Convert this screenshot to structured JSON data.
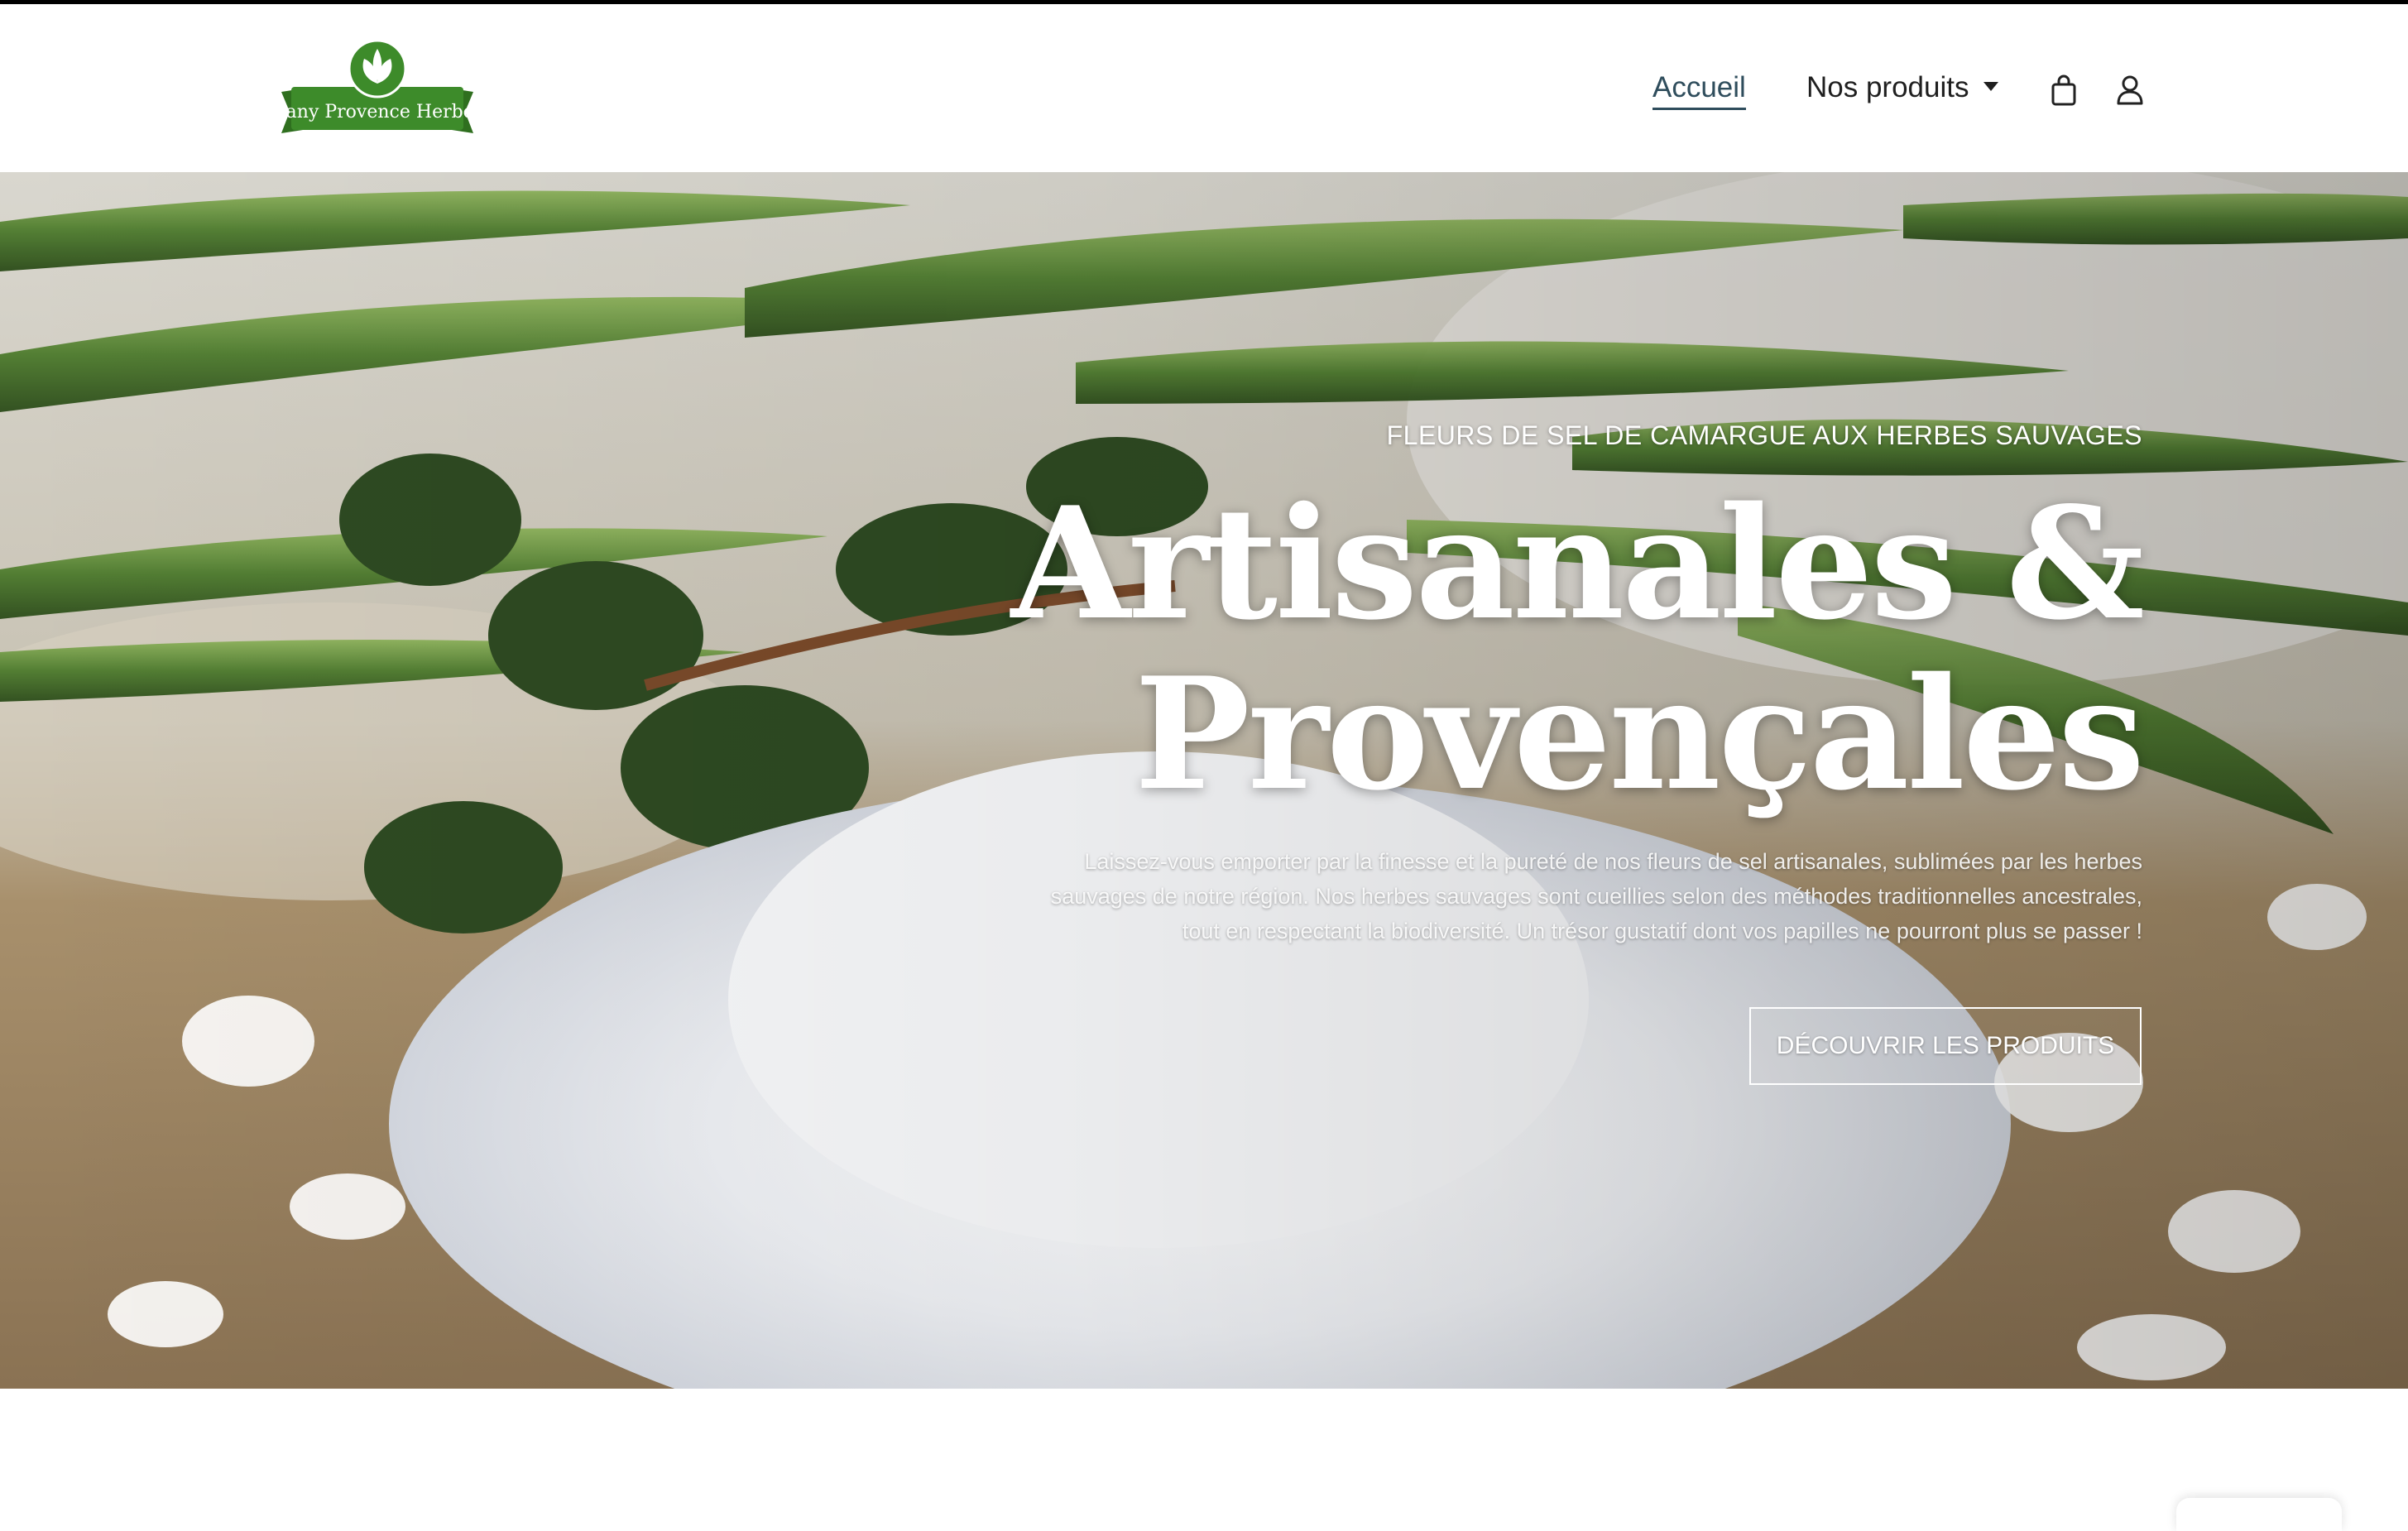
{
  "brand": {
    "logo_text": "Dany Provence Herbes",
    "logo_color": "#3d8b2a"
  },
  "nav": {
    "home_label": "Accueil",
    "products_label": "Nos produits",
    "cart_icon": "shopping-bag-icon",
    "account_icon": "user-icon"
  },
  "hero": {
    "eyebrow": "FLEURS DE SEL DE CAMARGUE AUX HERBES SAUVAGES",
    "headline_line1": "Artisanales &",
    "headline_line2": "Provençales",
    "lede": "Laissez-vous emporter par la finesse et la pureté de nos fleurs de sel artisanales, sublimées par les herbes sauvages de notre région. Nos herbes sauvages sont cueillies selon des méthodes traditionnelles ancestrales, tout en respectant la biodiversité. Un trésor gustatif dont vos papilles ne pourront plus se passer !",
    "cta_label": "DÉCOUVRIR LES PRODUITS",
    "image_subject": "rosemary-thyme-and-sea-salt-photo"
  }
}
